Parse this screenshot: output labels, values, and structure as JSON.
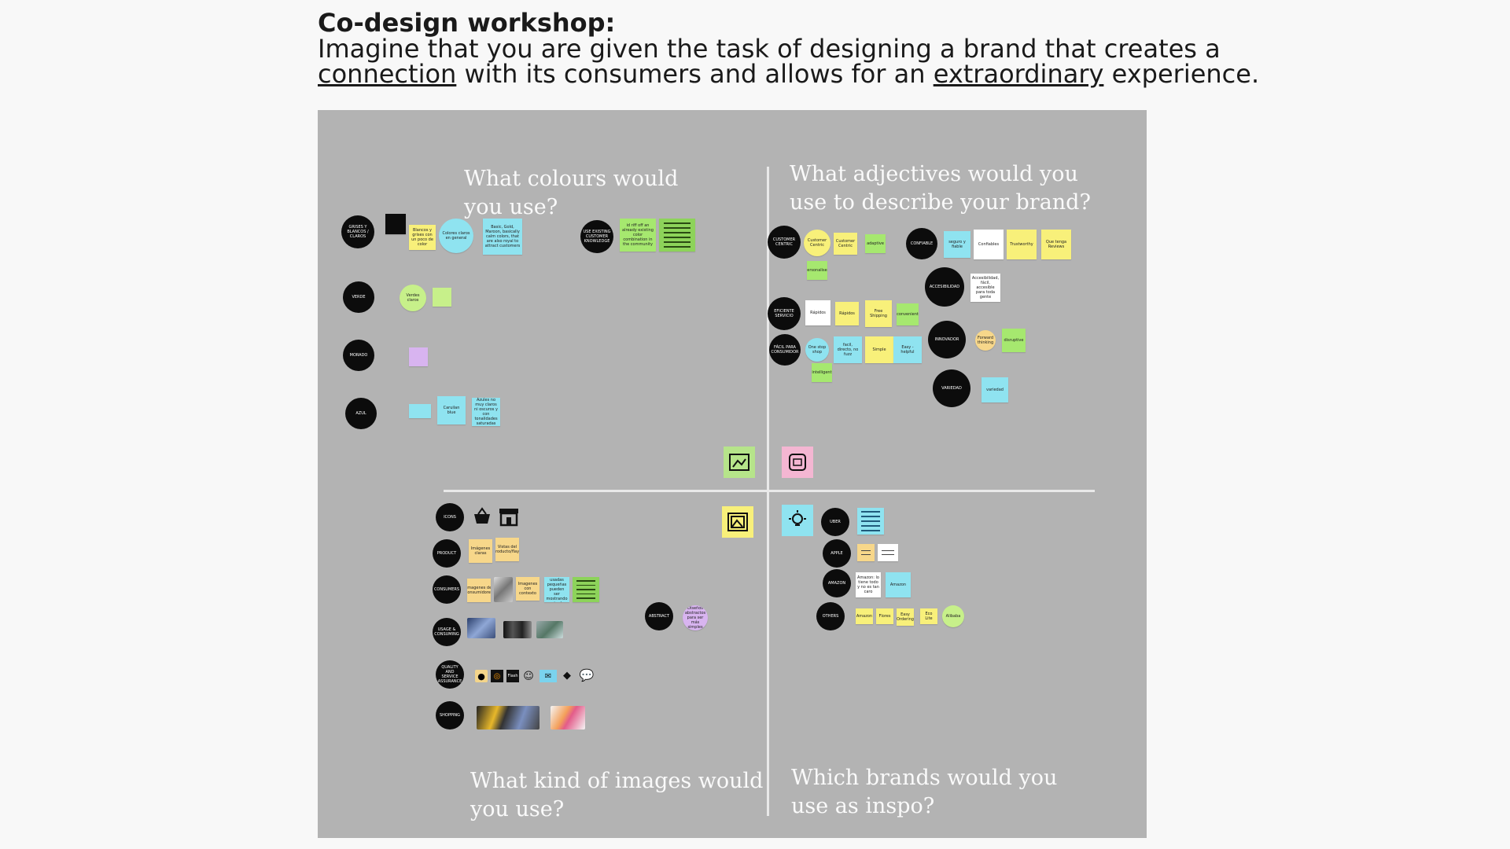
{
  "header": {
    "title": "Co-design workshop:",
    "line1": "Imagine that you are given the task of designing a brand that creates a",
    "line2_u1": "connection",
    "line2_mid": " with its consumers and allows for an ",
    "line2_u2": "extraordinary",
    "line2_end": " experience."
  },
  "questions": {
    "colours": "What colours would you use?",
    "adjectives": "What adjectives would you use to describe your brand?",
    "images": "What kind of images would you use?",
    "brands": "Which brands would you use as inspo?"
  },
  "colours": {
    "c1": "GRISES Y BLANCOS / CLAROS",
    "c1_note1": "Blancos y grises con un poco de color",
    "c1_note2": "Colores claros en general",
    "c1_note3": "Basic, Gold, Maroon, basically calm colors, that are also royal to attract customers",
    "c2": "USE EXISTING CUSTOMER KNOWLEDGE",
    "c2_note1": "id riff off an already existing color combination in the community",
    "verde": "VERDE",
    "verde_note": "Verdes claros",
    "morado": "MORADO",
    "azul": "AZUL",
    "azul_note1": "Caruilan blue",
    "azul_note2": "Azules no muy claros ni oscuros y con tonalidades saturadas"
  },
  "adjectives": {
    "customer_centric": "CUSTOMER CENTRIC",
    "cc_note1": "Customer Centric",
    "cc_note2": "Customer Centric",
    "cc_note3": "adaptive",
    "cc_note4": "personalised",
    "confiable": "CONFIABLE",
    "conf_note1": "seguro y fiable",
    "conf_note2": "Confiables",
    "conf_note3": "Trustworthy",
    "conf_note4": "Que tenga Reviews",
    "eficiente": "EFICIENTE SERVICIO",
    "ef_note1": "Rápidos",
    "ef_note2": "Rápidos",
    "ef_note3": "Free Shipping",
    "ef_note4": "convenient",
    "facil": "FÁCIL PARA CONSUMIDOR",
    "fa_note1": "One stop shop",
    "fa_note2": "facil, directo, no fuzz",
    "fa_note3": "Simple",
    "fa_note4": "Easy - helpful",
    "fa_note5": "intelligent",
    "accesibilidad": "ACCESIBILIDAD",
    "acc_note": "Accesibilidad, fácil, accesible para toda gente",
    "innovador": "INNOVADOR",
    "inn_note1": "Forward thinking",
    "inn_note2": "disruptive",
    "variedad": "VARIEDAD",
    "var_note": "variedad"
  },
  "images": {
    "icons": "ICONS",
    "product": "PRODUCT",
    "pr_note1": "Imágenes claras",
    "pr_note2": "Vistas del producto/flaye",
    "consumers": "CONSUMERS",
    "con_note1": "Imagenes de consumidores",
    "con_note2": "Imagenes con contexto",
    "con_note3": "Quizás las imágenes usadas pequeñas pueden ser mostrando mejor los productos",
    "usage": "USAGE & CONSUMING",
    "quality": "QUALITY AND SERVICE ASSURANCE",
    "shopping": "SHOPPING",
    "abstract": "ABSTRACT",
    "abs_note": "Diseños abstractos para ser más simples",
    "flash_label": "Flash"
  },
  "brands": {
    "uber": "UBER",
    "apple": "APPLE",
    "amazon": "AMAZON",
    "am_note1": "Amazon: lo tiene todo y no es tan caro",
    "am_note2": "Amazon",
    "others": "OTHERS",
    "ot_note1": "Amazon",
    "ot_note2": "Flores",
    "ot_note3": "Easy Ordering",
    "ot_note4": "Eco Lite",
    "ot_note5": "Alibaba"
  },
  "colors": {
    "board_bg": "#b3b3b3",
    "circle": "#0c0c0c",
    "axis": "#e9e9e9",
    "question_text": "#fafafa"
  }
}
